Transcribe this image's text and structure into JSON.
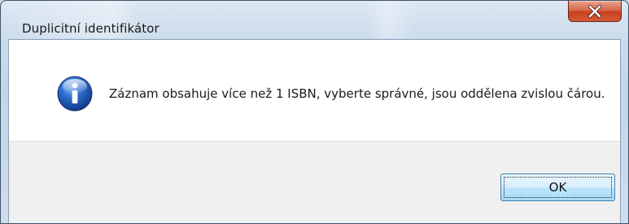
{
  "window": {
    "title": "Duplicitní identifikátor"
  },
  "titlebar": {
    "close_icon": "close-icon"
  },
  "dialog": {
    "icon": "info-icon",
    "message": "Záznam obsahuje více než 1 ISBN, vyberte správné, jsou oddělena zvislou čárou."
  },
  "buttons": {
    "ok_label": "OK"
  },
  "colors": {
    "close_button": "#c8401f",
    "info_icon_blue": "#1f5ab8",
    "ok_button_border": "#3c7fb1",
    "button_bar_bg": "#f0f0f0"
  }
}
